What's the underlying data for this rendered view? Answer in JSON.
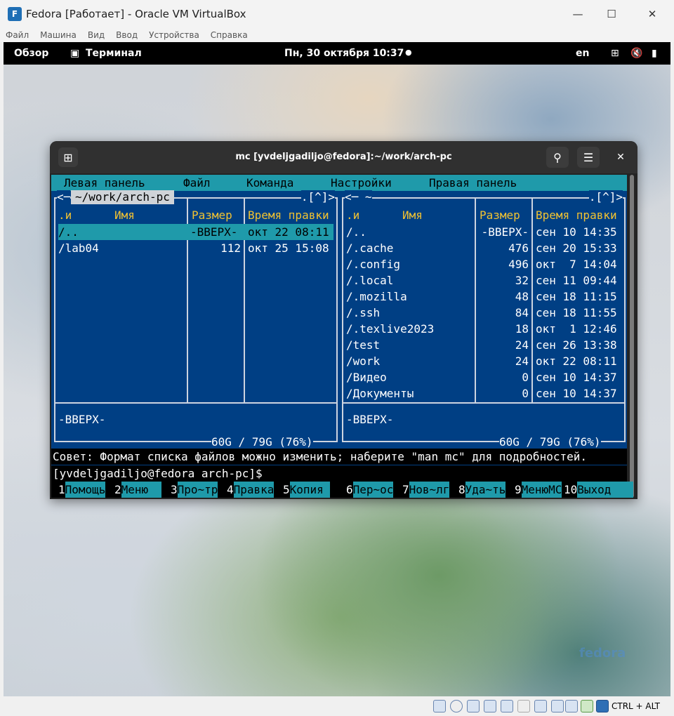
{
  "vbox": {
    "title": "Fedora [Работает] - Oracle VM VirtualBox",
    "logo_glyph": "F",
    "controls": {
      "minimize": "—",
      "maximize": "☐",
      "close": "✕"
    },
    "menu": [
      "Файл",
      "Машина",
      "Вид",
      "Ввод",
      "Устройства",
      "Справка"
    ],
    "hostkey": "CTRL + ALT"
  },
  "gnome": {
    "overview": "Обзор",
    "app_icon": "▣",
    "app": "Терминал",
    "clock": "Пн, 30 октября  10:37",
    "notification_dot": "●",
    "lang": "en",
    "network_icon": "⊞",
    "sound_icon": "🔇",
    "battery_icon": "▮",
    "watermark": "fedora"
  },
  "terminal": {
    "title": "mc [yvdeljgadiljo@fedora]:~/work/arch-pc",
    "newtab_icon": "⊞",
    "search_icon": "⚲",
    "menu_icon": "☰",
    "close_icon": "✕"
  },
  "mc": {
    "menubar": [
      "Левая панель",
      "Файл",
      "Команда",
      "Настройки",
      "Правая панель"
    ],
    "left": {
      "corner_left": "<─",
      "path": "~/work/arch-pc",
      "corner_right": ".[^]>",
      "headers": {
        "n": ".и",
        "name": "Имя",
        "size": "Размер",
        "time": "Время правки"
      },
      "rows": [
        {
          "name": "/..",
          "size": "-ВВЕРХ-",
          "time": "окт 22 08:11",
          "selected": true
        },
        {
          "name": "/lab04",
          "size": "112",
          "time": "окт 25 15:08",
          "selected": false
        }
      ],
      "status": "-ВВЕРХ-",
      "free": "60G / 79G (76%)"
    },
    "right": {
      "corner_left": "<─ ~",
      "corner_right": ".[^]>",
      "headers": {
        "n": ".и",
        "name": "Имя",
        "size": "Размер",
        "time": "Время правки"
      },
      "rows": [
        {
          "name": "/..",
          "size": "-ВВЕРХ-",
          "time": "сен 10 14:35"
        },
        {
          "name": "/.cache",
          "size": "476",
          "time": "сен 20 15:33"
        },
        {
          "name": "/.config",
          "size": "496",
          "time": "окт  7 14:04"
        },
        {
          "name": "/.local",
          "size": "32",
          "time": "сен 11 09:44"
        },
        {
          "name": "/.mozilla",
          "size": "48",
          "time": "сен 18 11:15"
        },
        {
          "name": "/.ssh",
          "size": "84",
          "time": "сен 18 11:55"
        },
        {
          "name": "/.texlive2023",
          "size": "18",
          "time": "окт  1 12:46"
        },
        {
          "name": "/test",
          "size": "24",
          "time": "сен 26 13:38"
        },
        {
          "name": "/work",
          "size": "24",
          "time": "окт 22 08:11"
        },
        {
          "name": "/Видео",
          "size": "0",
          "time": "сен 10 14:37"
        },
        {
          "name": "/Документы",
          "size": "0",
          "time": "сен 10 14:37"
        }
      ],
      "status": "-ВВЕРХ-",
      "free": "60G / 79G (76%)"
    },
    "hint": "Совет: Формат списка файлов можно изменить; наберите \"man mc\" для подробностей.",
    "prompt": "[yvdeljgadiljo@fedora arch-pc]$",
    "fkeys": [
      {
        "n": "1",
        "label": "Помощь"
      },
      {
        "n": "2",
        "label": "Меню  "
      },
      {
        "n": "3",
        "label": "Про~тр"
      },
      {
        "n": "4",
        "label": "Правка"
      },
      {
        "n": "5",
        "label": "Копия "
      },
      {
        "n": "6",
        "label": "Пер~ос"
      },
      {
        "n": "7",
        "label": "Нов~лг"
      },
      {
        "n": "8",
        "label": "Уда~ть"
      },
      {
        "n": "9",
        "label": "МенюMC"
      },
      {
        "n": "10",
        "label": "Выход "
      }
    ]
  }
}
